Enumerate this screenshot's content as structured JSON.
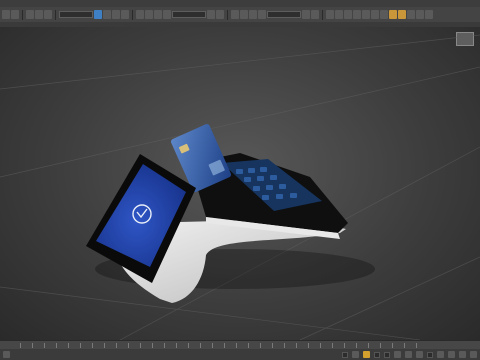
{
  "menubar": {
    "items": [
      "",
      "",
      "",
      "",
      "",
      "",
      "",
      "",
      "",
      "",
      "",
      "",
      ""
    ]
  },
  "toolbar": {
    "selection_set_placeholder": "",
    "coordinate_dropdown": ""
  },
  "ribbon": {
    "tag1": "",
    "tag2": ""
  },
  "viewport": {
    "label": "",
    "scene": {
      "card_brand": "",
      "screen_status": "",
      "device_brand": ""
    }
  },
  "statusbar": {
    "grid_field": "",
    "autokey_label": "",
    "keyfilters_label": "",
    "frame_counter": ""
  },
  "colors": {
    "screen_blue": "#1e3fa8",
    "card_blue": "#2a5aa6",
    "device_body": "#e8e8e8",
    "device_bezel": "#0d0d0d"
  }
}
